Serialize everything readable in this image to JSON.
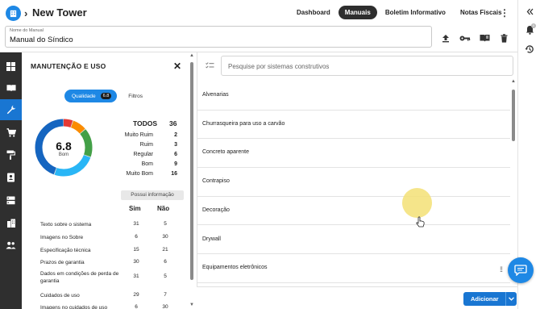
{
  "header": {
    "title": "New Tower",
    "tabs": [
      {
        "label": "Dashboard",
        "active": false
      },
      {
        "label": "Manuais",
        "active": true
      },
      {
        "label": "Boletim Informativo",
        "active": false
      },
      {
        "label": "Notas Fiscais",
        "active": false
      }
    ]
  },
  "manual": {
    "label": "Nome do Manual",
    "value": "Manual do Síndico"
  },
  "notifications": {
    "count": "0"
  },
  "panel": {
    "title": "MANUTENÇÃO E USO",
    "segment": {
      "quality_label": "Qualidade",
      "quality_badge": "6.8",
      "filters_label": "Filtros"
    },
    "score": {
      "value": "6.8",
      "label": "Bom"
    },
    "counts": {
      "total_label": "TODOS",
      "total_value": "36",
      "rows": [
        {
          "label": "Muito Ruim",
          "value": "2"
        },
        {
          "label": "Ruim",
          "value": "3"
        },
        {
          "label": "Regular",
          "value": "6"
        },
        {
          "label": "Bom",
          "value": "9"
        },
        {
          "label": "Muito Bom",
          "value": "16"
        }
      ]
    },
    "info_badge": "Possui informação",
    "table": {
      "headers": [
        "Sim",
        "Não"
      ],
      "rows": [
        {
          "label": "Texto sobre o sistema",
          "sim": "31",
          "nao": "5"
        },
        {
          "label": "Imagens no Sobre",
          "sim": "6",
          "nao": "30"
        },
        {
          "label": "Especificação técnica",
          "sim": "15",
          "nao": "21"
        },
        {
          "label": "Prazos de garantia",
          "sim": "30",
          "nao": "6"
        },
        {
          "label": "Dados em condições de perda de garantia",
          "sim": "31",
          "nao": "5"
        },
        {
          "label": "Cuidados de uso",
          "sim": "29",
          "nao": "7"
        },
        {
          "label": "Imagens no cuidados de uso",
          "sim": "6",
          "nao": "30"
        }
      ]
    }
  },
  "donut": {
    "segments": [
      {
        "name": "Muito Ruim",
        "value": 2,
        "color": "#e53935"
      },
      {
        "name": "Ruim",
        "value": 3,
        "color": "#fb8c00"
      },
      {
        "name": "Regular",
        "value": 6,
        "color": "#43a047"
      },
      {
        "name": "Bom",
        "value": 9,
        "color": "#29b6f6"
      },
      {
        "name": "Muito Bom",
        "value": 16,
        "color": "#1565c0"
      }
    ],
    "track_color": "#e0e0e0"
  },
  "search": {
    "placeholder": "Pesquise por sistemas construtivos"
  },
  "systems": [
    "Alvenarias",
    "Churrasqueira para uso a carvão",
    "Concreto aparente",
    "Contrapiso",
    "Decoração",
    "Drywall",
    "Equipamentos eletrônicos"
  ],
  "actions": {
    "add_label": "Adicionar"
  },
  "colors": {
    "accent": "#1976d2",
    "nav_bg": "#2f2f2f",
    "tab_active": "#2e2e2e"
  }
}
